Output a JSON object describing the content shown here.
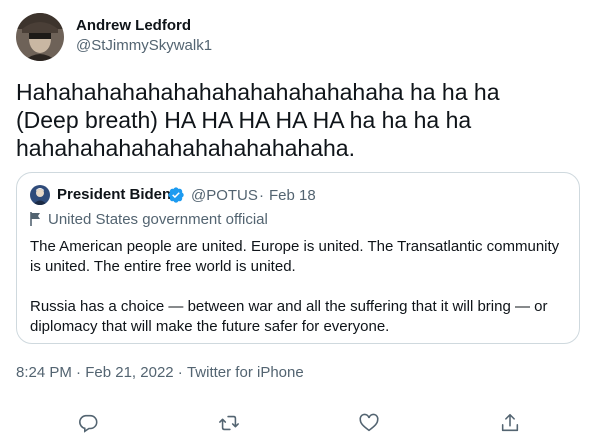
{
  "author": {
    "name": "Andrew Ledford",
    "handle": "@StJimmySkywalk1",
    "avatar_icon": "profile-photo-icon"
  },
  "tweet": {
    "lines": [
      "Hahahahahahahahahahahahahahaha ha ha ha",
      "(Deep breath) HA HA HA HA HA ha ha ha ha",
      "hahahahahahahahahahahahaha."
    ]
  },
  "quote": {
    "name": "President Biden",
    "handle": "@POTUS",
    "separator": "·",
    "date": "Feb 18",
    "label": "United States government official",
    "paragraphs": [
      "The American people are united. Europe is united. The Transatlantic community is united. The entire free world is united.",
      "Russia has a choice — between war and all the suffering that it will bring — or diplomacy that will make the future safer for everyone."
    ],
    "verified_color": "#1d9bf0"
  },
  "meta": {
    "time": "8:24 PM",
    "separator": "·",
    "date": "Feb 21, 2022",
    "source": "Twitter for iPhone"
  },
  "actions": [
    "reply-icon",
    "retweet-icon",
    "like-icon",
    "share-icon"
  ],
  "colors": {
    "text": "#0f1419",
    "secondary": "#536471",
    "border": "#cfd9de",
    "accent": "#1d9bf0"
  }
}
